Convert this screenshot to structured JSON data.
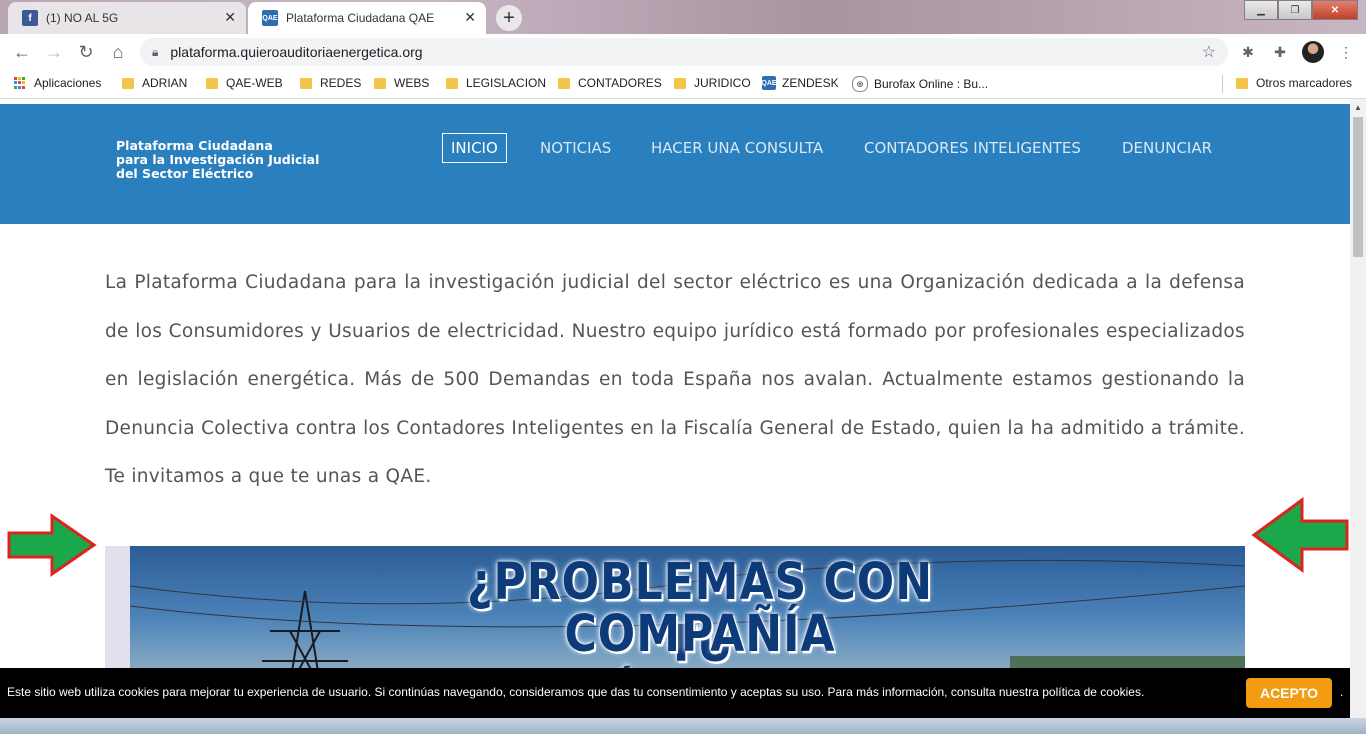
{
  "tabs": [
    {
      "title": "(1) NO AL 5G",
      "favicon": "f"
    },
    {
      "title": "Plataforma Ciudadana QAE",
      "favicon": "QAE"
    }
  ],
  "toolbar": {
    "url": "plataforma.quieroauditoriaenergetica.org"
  },
  "bookmarks": {
    "apps": "Aplicaciones",
    "items": [
      "ADRIAN",
      "QAE-WEB",
      "REDES",
      "WEBS",
      "LEGISLACION",
      "CONTADORES",
      "JURIDICO",
      "ZENDESK",
      "Burofax Online : Bu..."
    ],
    "other": "Otros marcadores"
  },
  "site": {
    "logo_lines": [
      "Plataforma Ciudadana",
      "para la Investigación Judicial",
      "del Sector Eléctrico"
    ],
    "nav": [
      "INICIO",
      "NOTICIAS",
      "HACER UNA CONSULTA",
      "CONTADORES INTELIGENTES",
      "DENUNCIAR"
    ],
    "intro": "La Plataforma Ciudadana para la investigación judicial del sector eléctrico es una Organización dedicada a la defensa de los Consumidores y Usuarios de electricidad. Nuestro equipo jurídico está formado por profesionales especializados en legislación energética. Más de 500 Demandas en toda España nos avalan. Actualmente estamos gestionando la Denuncia Colectiva contra los Contadores Inteligentes en la Fiscalía General de Estado, quien la ha admitido a trámite. Te invitamos a que te unas a QAE.",
    "banner_lines": [
      "¿PROBLEMAS CON TU",
      "COMPAÑÍA ELÉCTRICA?"
    ]
  },
  "cookie": {
    "text": "Este sitio web utiliza cookies para mejorar tu experiencia de usuario. Si continúas navegando, consideramos que das tu consentimiento y aceptas su uso. Para más información, consulta nuestra política de cookies.",
    "button": "ACEPTO",
    "trailing": "."
  },
  "colors": {
    "header": "#2a7fbe",
    "accept": "#f39c12",
    "arrow_fill": "#1aa84a",
    "arrow_stroke": "#e0221f"
  }
}
